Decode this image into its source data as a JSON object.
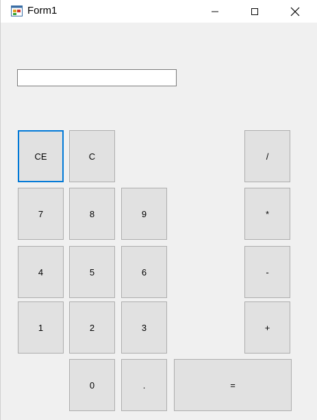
{
  "window": {
    "title": "Form1",
    "icons": {
      "app": "winforms-app-icon",
      "minimize": "minimize-icon",
      "maximize": "maximize-icon",
      "close": "close-icon"
    }
  },
  "display": {
    "value": ""
  },
  "buttons": {
    "ce": "CE",
    "c": "C",
    "divide": "/",
    "seven": "7",
    "eight": "8",
    "nine": "9",
    "multiply": "*",
    "four": "4",
    "five": "5",
    "six": "6",
    "subtract": "-",
    "one": "1",
    "two": "2",
    "three": "3",
    "add": "+",
    "zero": "0",
    "decimal": ".",
    "equals": "="
  },
  "colors": {
    "focus_border": "#0078d7",
    "button_face": "#e1e1e1",
    "form_background": "#f0f0f0"
  }
}
